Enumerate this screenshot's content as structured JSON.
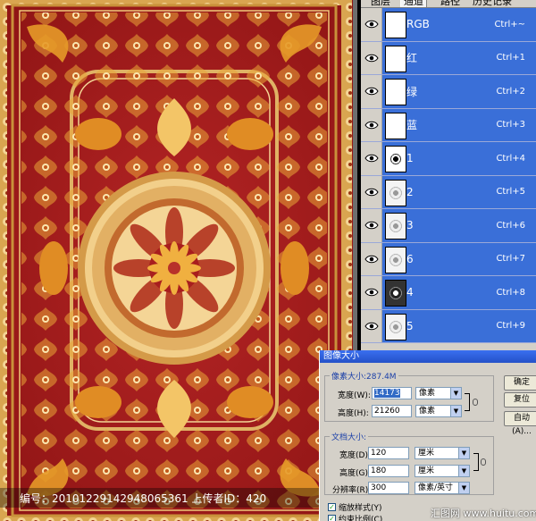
{
  "channels_panel": {
    "tabs": [
      "图层",
      "通道",
      "路径",
      "历史记录"
    ],
    "rows": [
      {
        "name": "RGB",
        "shortcut": "Ctrl+~",
        "thumb": "white"
      },
      {
        "name": "红",
        "shortcut": "Ctrl+1",
        "thumb": "white"
      },
      {
        "name": "绿",
        "shortcut": "Ctrl+2",
        "thumb": "white"
      },
      {
        "name": "蓝",
        "shortcut": "Ctrl+3",
        "thumb": "white"
      },
      {
        "name": "1",
        "shortcut": "Ctrl+4",
        "thumb": "pattern"
      },
      {
        "name": "2",
        "shortcut": "Ctrl+5",
        "thumb": "light"
      },
      {
        "name": "3",
        "shortcut": "Ctrl+6",
        "thumb": "light"
      },
      {
        "name": "6",
        "shortcut": "Ctrl+7",
        "thumb": "light"
      },
      {
        "name": "4",
        "shortcut": "Ctrl+8",
        "thumb": "dark"
      },
      {
        "name": "5",
        "shortcut": "Ctrl+9",
        "thumb": "light"
      }
    ]
  },
  "dialog": {
    "title": "图像大小",
    "pixel_dims_label": "像素大小:287.4M",
    "width_label": "宽度(W):",
    "width_value": "14173",
    "width_unit": "像素",
    "height_label": "高度(H):",
    "height_value": "21260",
    "height_unit": "像素",
    "doc_size_label": "文档大小:",
    "doc_width_label": "宽度(D):",
    "doc_width_value": "120",
    "doc_width_unit": "厘米",
    "doc_height_label": "高度(G):",
    "doc_height_value": "180",
    "doc_height_unit": "厘米",
    "resolution_label": "分辨率(R):",
    "resolution_value": "300",
    "resolution_unit": "像素/英寸",
    "scale_styles_label": "缩放样式(Y)",
    "constrain_label": "约束比例(C)",
    "ok_label": "确定",
    "reset_label": "复位",
    "auto_label": "自动(A)..."
  },
  "watermark": {
    "code": "编号：20101229142948065361 上传者ID：420",
    "site": "汇图网 www.huitu.com"
  },
  "colors": {
    "carpet_red": "#a81e1e",
    "carpet_gold": "#e8a12c",
    "selection_blue": "#3a6fd8",
    "panel_gray": "#d4d0c8"
  }
}
